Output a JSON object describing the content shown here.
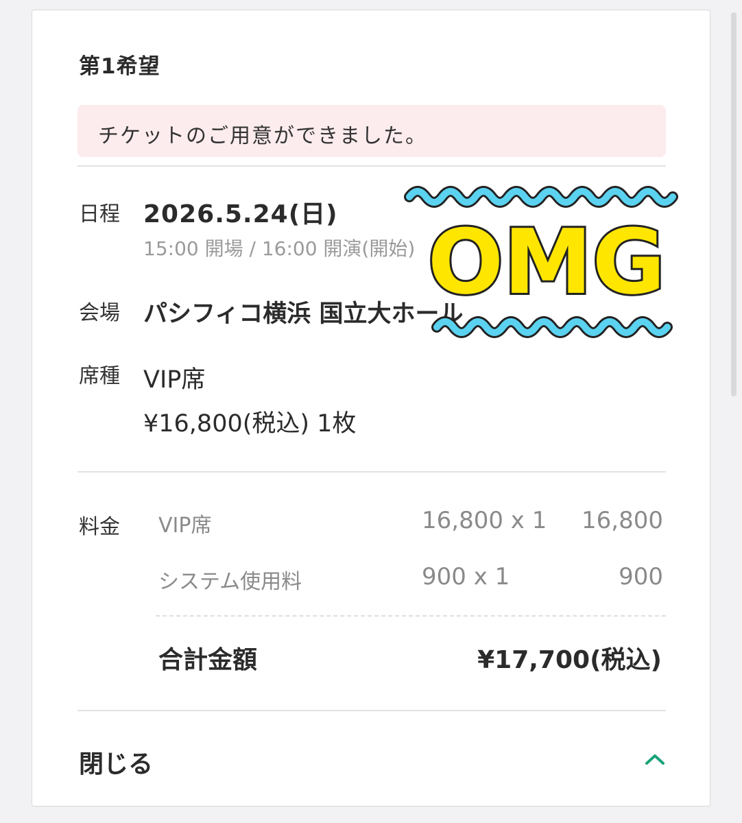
{
  "preference": {
    "heading": "第1希望"
  },
  "notice": {
    "text": "チケットのご用意ができました。"
  },
  "details": {
    "date_label": "日程",
    "date_value": "2026.5.24(日)",
    "time_value": "15:00 開場 / 16:00 開演(開始)",
    "venue_label": "会場",
    "venue_value": "パシフィコ横浜 国立大ホール",
    "seat_label": "席種",
    "seat_value": "VIP席",
    "price_value": "¥16,800(税込) 1枚"
  },
  "fees": {
    "label": "料金",
    "items": [
      {
        "name": "VIP席",
        "qty": "16,800 x 1",
        "subtotal": "16,800"
      },
      {
        "name": "システム使用料",
        "qty": "900 x 1",
        "subtotal": "900"
      }
    ],
    "total_label": "合計金額",
    "total_value": "¥17,700(税込)"
  },
  "footer": {
    "close_label": "閉じる",
    "icon": "chevron-up-icon"
  },
  "sticker": {
    "text": "OMG",
    "text_color": "#ffe600",
    "wave_color": "#5ad2f0"
  },
  "colors": {
    "accent": "#1aa37a",
    "notice_bg": "#fcecee"
  }
}
